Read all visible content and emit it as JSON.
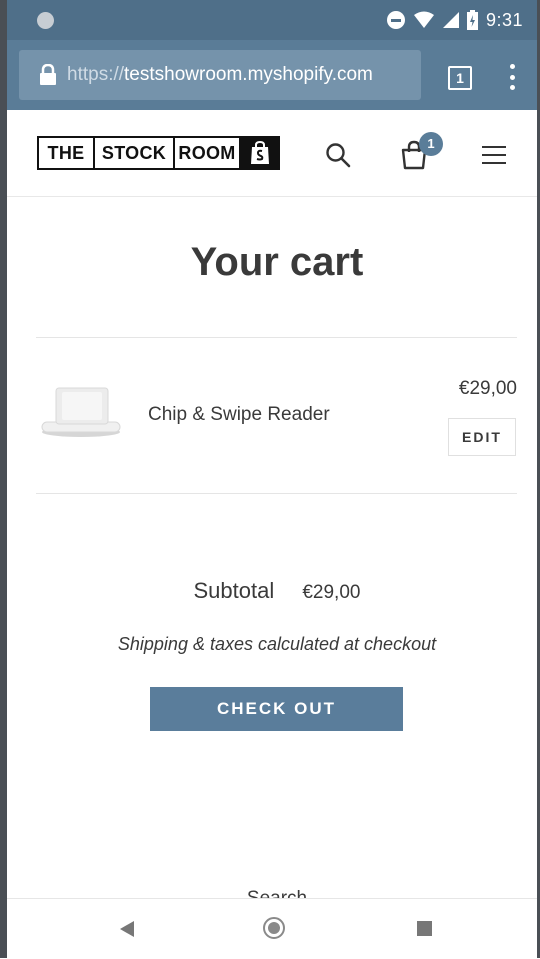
{
  "status_bar": {
    "time": "9:31"
  },
  "browser": {
    "url_scheme": "https://",
    "url_host": "testshowroom.myshopify.com",
    "tab_count": "1"
  },
  "store": {
    "logo_words": [
      "THE",
      "STOCK",
      "ROOM"
    ],
    "cart_count": "1"
  },
  "cart": {
    "title": "Your cart",
    "items": [
      {
        "name": "Chip & Swipe Reader",
        "price": "€29,00",
        "edit_label": "EDIT"
      }
    ],
    "subtotal_label": "Subtotal",
    "subtotal_value": "€29,00",
    "shipping_note": "Shipping & taxes calculated at checkout",
    "checkout_label": "CHECK OUT"
  },
  "footer": {
    "peek_text": "Search"
  },
  "colors": {
    "accent": "#5a7d9b",
    "browser_bar": "#5a7c97",
    "status_bar": "#4f6f89"
  }
}
